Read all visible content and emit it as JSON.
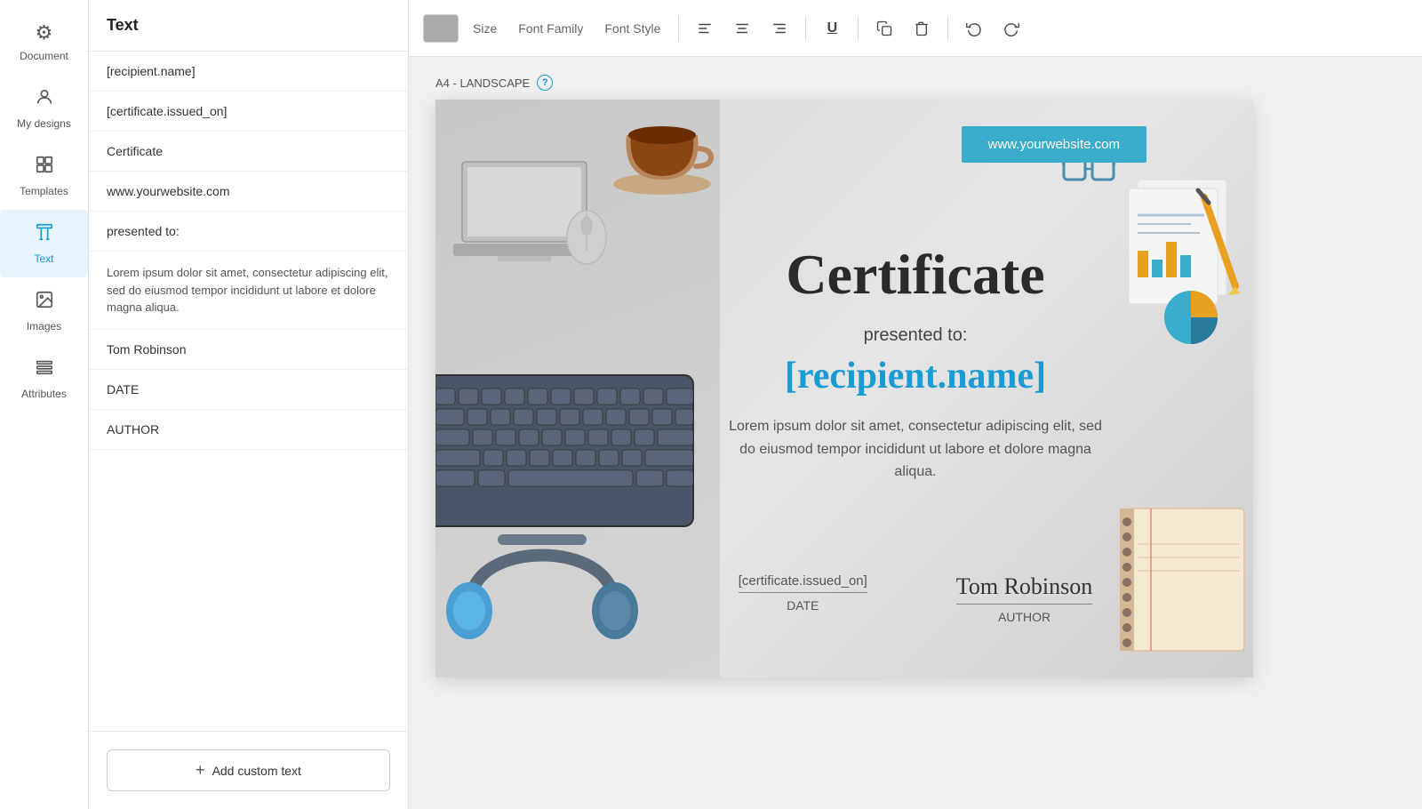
{
  "sidebar": {
    "items": [
      {
        "id": "document",
        "label": "Document",
        "icon": "⚙",
        "active": false
      },
      {
        "id": "my-designs",
        "label": "My designs",
        "icon": "👤",
        "active": false
      },
      {
        "id": "templates",
        "label": "Templates",
        "icon": "⬆",
        "active": false
      },
      {
        "id": "text",
        "label": "Text",
        "icon": "T",
        "active": true
      },
      {
        "id": "images",
        "label": "Images",
        "icon": "🖼",
        "active": false
      },
      {
        "id": "attributes",
        "label": "Attributes",
        "icon": "≡",
        "active": false
      }
    ]
  },
  "panel": {
    "title": "Text",
    "items": [
      "[recipient.name]",
      "[certificate.issued_on]",
      "Certificate",
      "www.yourwebsite.com",
      "presented to:",
      "Lorem ipsum dolor sit amet, consectetur adipiscing elit, sed do eiusmod tempor incididunt ut labore et dolore magna aliqua.",
      "Tom Robinson",
      "DATE",
      "AUTHOR"
    ],
    "add_button_label": "Add custom text",
    "add_button_plus": "+"
  },
  "toolbar": {
    "color_box": "#aaaaaa",
    "size_label": "Size",
    "font_family_label": "Font Family",
    "font_style_label": "Font Style",
    "align_left": "align-left",
    "align_center": "align-center",
    "align_right": "align-right",
    "underline": "U",
    "copy": "copy",
    "delete": "delete",
    "undo": "undo",
    "redo": "redo"
  },
  "canvas": {
    "format_label": "A4 - LANDSCAPE",
    "help_label": "?",
    "website_banner": "www.yourwebsite.com",
    "cert_title": "Certificate",
    "cert_presented": "presented to:",
    "cert_recipient": "[recipient.name]",
    "cert_lorem": "Lorem ipsum dolor sit amet, consectetur adipiscing elit, sed do eiusmod tempor incididunt ut labore et dolore magna aliqua.",
    "sig1_value": "[certificate.issued_on]",
    "sig1_label": "DATE",
    "sig2_value": "Tom Robinson",
    "sig2_label": "AUTHOR"
  }
}
